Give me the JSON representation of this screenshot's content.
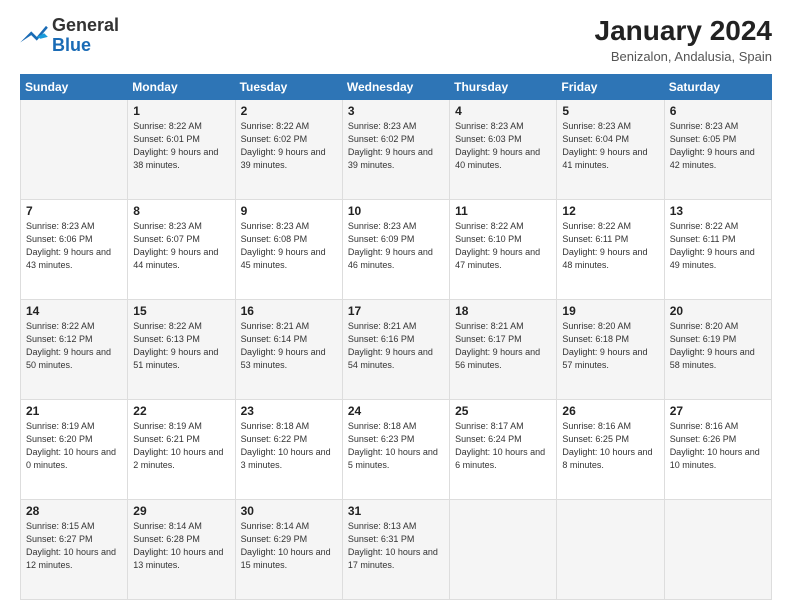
{
  "logo": {
    "general": "General",
    "blue": "Blue"
  },
  "title": "January 2024",
  "subtitle": "Benizalon, Andalusia, Spain",
  "days_of_week": [
    "Sunday",
    "Monday",
    "Tuesday",
    "Wednesday",
    "Thursday",
    "Friday",
    "Saturday"
  ],
  "weeks": [
    [
      {
        "day": null,
        "sunrise": null,
        "sunset": null,
        "daylight": null
      },
      {
        "day": "1",
        "sunrise": "Sunrise: 8:22 AM",
        "sunset": "Sunset: 6:01 PM",
        "daylight": "Daylight: 9 hours and 38 minutes."
      },
      {
        "day": "2",
        "sunrise": "Sunrise: 8:22 AM",
        "sunset": "Sunset: 6:02 PM",
        "daylight": "Daylight: 9 hours and 39 minutes."
      },
      {
        "day": "3",
        "sunrise": "Sunrise: 8:23 AM",
        "sunset": "Sunset: 6:02 PM",
        "daylight": "Daylight: 9 hours and 39 minutes."
      },
      {
        "day": "4",
        "sunrise": "Sunrise: 8:23 AM",
        "sunset": "Sunset: 6:03 PM",
        "daylight": "Daylight: 9 hours and 40 minutes."
      },
      {
        "day": "5",
        "sunrise": "Sunrise: 8:23 AM",
        "sunset": "Sunset: 6:04 PM",
        "daylight": "Daylight: 9 hours and 41 minutes."
      },
      {
        "day": "6",
        "sunrise": "Sunrise: 8:23 AM",
        "sunset": "Sunset: 6:05 PM",
        "daylight": "Daylight: 9 hours and 42 minutes."
      }
    ],
    [
      {
        "day": "7",
        "sunrise": "Sunrise: 8:23 AM",
        "sunset": "Sunset: 6:06 PM",
        "daylight": "Daylight: 9 hours and 43 minutes."
      },
      {
        "day": "8",
        "sunrise": "Sunrise: 8:23 AM",
        "sunset": "Sunset: 6:07 PM",
        "daylight": "Daylight: 9 hours and 44 minutes."
      },
      {
        "day": "9",
        "sunrise": "Sunrise: 8:23 AM",
        "sunset": "Sunset: 6:08 PM",
        "daylight": "Daylight: 9 hours and 45 minutes."
      },
      {
        "day": "10",
        "sunrise": "Sunrise: 8:23 AM",
        "sunset": "Sunset: 6:09 PM",
        "daylight": "Daylight: 9 hours and 46 minutes."
      },
      {
        "day": "11",
        "sunrise": "Sunrise: 8:22 AM",
        "sunset": "Sunset: 6:10 PM",
        "daylight": "Daylight: 9 hours and 47 minutes."
      },
      {
        "day": "12",
        "sunrise": "Sunrise: 8:22 AM",
        "sunset": "Sunset: 6:11 PM",
        "daylight": "Daylight: 9 hours and 48 minutes."
      },
      {
        "day": "13",
        "sunrise": "Sunrise: 8:22 AM",
        "sunset": "Sunset: 6:11 PM",
        "daylight": "Daylight: 9 hours and 49 minutes."
      }
    ],
    [
      {
        "day": "14",
        "sunrise": "Sunrise: 8:22 AM",
        "sunset": "Sunset: 6:12 PM",
        "daylight": "Daylight: 9 hours and 50 minutes."
      },
      {
        "day": "15",
        "sunrise": "Sunrise: 8:22 AM",
        "sunset": "Sunset: 6:13 PM",
        "daylight": "Daylight: 9 hours and 51 minutes."
      },
      {
        "day": "16",
        "sunrise": "Sunrise: 8:21 AM",
        "sunset": "Sunset: 6:14 PM",
        "daylight": "Daylight: 9 hours and 53 minutes."
      },
      {
        "day": "17",
        "sunrise": "Sunrise: 8:21 AM",
        "sunset": "Sunset: 6:16 PM",
        "daylight": "Daylight: 9 hours and 54 minutes."
      },
      {
        "day": "18",
        "sunrise": "Sunrise: 8:21 AM",
        "sunset": "Sunset: 6:17 PM",
        "daylight": "Daylight: 9 hours and 56 minutes."
      },
      {
        "day": "19",
        "sunrise": "Sunrise: 8:20 AM",
        "sunset": "Sunset: 6:18 PM",
        "daylight": "Daylight: 9 hours and 57 minutes."
      },
      {
        "day": "20",
        "sunrise": "Sunrise: 8:20 AM",
        "sunset": "Sunset: 6:19 PM",
        "daylight": "Daylight: 9 hours and 58 minutes."
      }
    ],
    [
      {
        "day": "21",
        "sunrise": "Sunrise: 8:19 AM",
        "sunset": "Sunset: 6:20 PM",
        "daylight": "Daylight: 10 hours and 0 minutes."
      },
      {
        "day": "22",
        "sunrise": "Sunrise: 8:19 AM",
        "sunset": "Sunset: 6:21 PM",
        "daylight": "Daylight: 10 hours and 2 minutes."
      },
      {
        "day": "23",
        "sunrise": "Sunrise: 8:18 AM",
        "sunset": "Sunset: 6:22 PM",
        "daylight": "Daylight: 10 hours and 3 minutes."
      },
      {
        "day": "24",
        "sunrise": "Sunrise: 8:18 AM",
        "sunset": "Sunset: 6:23 PM",
        "daylight": "Daylight: 10 hours and 5 minutes."
      },
      {
        "day": "25",
        "sunrise": "Sunrise: 8:17 AM",
        "sunset": "Sunset: 6:24 PM",
        "daylight": "Daylight: 10 hours and 6 minutes."
      },
      {
        "day": "26",
        "sunrise": "Sunrise: 8:16 AM",
        "sunset": "Sunset: 6:25 PM",
        "daylight": "Daylight: 10 hours and 8 minutes."
      },
      {
        "day": "27",
        "sunrise": "Sunrise: 8:16 AM",
        "sunset": "Sunset: 6:26 PM",
        "daylight": "Daylight: 10 hours and 10 minutes."
      }
    ],
    [
      {
        "day": "28",
        "sunrise": "Sunrise: 8:15 AM",
        "sunset": "Sunset: 6:27 PM",
        "daylight": "Daylight: 10 hours and 12 minutes."
      },
      {
        "day": "29",
        "sunrise": "Sunrise: 8:14 AM",
        "sunset": "Sunset: 6:28 PM",
        "daylight": "Daylight: 10 hours and 13 minutes."
      },
      {
        "day": "30",
        "sunrise": "Sunrise: 8:14 AM",
        "sunset": "Sunset: 6:29 PM",
        "daylight": "Daylight: 10 hours and 15 minutes."
      },
      {
        "day": "31",
        "sunrise": "Sunrise: 8:13 AM",
        "sunset": "Sunset: 6:31 PM",
        "daylight": "Daylight: 10 hours and 17 minutes."
      },
      {
        "day": null,
        "sunrise": null,
        "sunset": null,
        "daylight": null
      },
      {
        "day": null,
        "sunrise": null,
        "sunset": null,
        "daylight": null
      },
      {
        "day": null,
        "sunrise": null,
        "sunset": null,
        "daylight": null
      }
    ]
  ]
}
